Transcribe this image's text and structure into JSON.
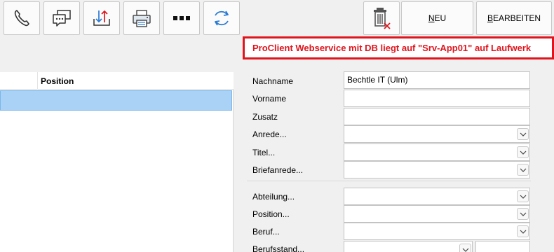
{
  "toolbar": {
    "icons": [
      "phone-icon",
      "chat-icon",
      "transfer-icon",
      "printer-icon",
      "more-icon",
      "refresh-icon"
    ],
    "trash_icon": "trash-icon",
    "new_label_u": "N",
    "new_label_rest": "EU",
    "edit_label_u": "B",
    "edit_label_rest": "EARBEITEN"
  },
  "banner": {
    "text": "ProClient Webservice mit DB liegt auf \"Srv-App01\" auf Laufwerk",
    "color": "#e0141c"
  },
  "list": {
    "column_header": "Position",
    "selected_color": "#a9d2f6"
  },
  "form": {
    "nachname_label": "Nachname",
    "nachname_value": "Bechtle IT (Ulm)",
    "vorname_label": "Vorname",
    "zusatz_label": "Zusatz",
    "anrede_label": "Anrede...",
    "titel_label": "Titel...",
    "briefanrede_label": "Briefanrede...",
    "abteilung_label": "Abteilung...",
    "position_label": "Position...",
    "beruf_label": "Beruf...",
    "berufsstand_label": "Berufsstand..."
  }
}
